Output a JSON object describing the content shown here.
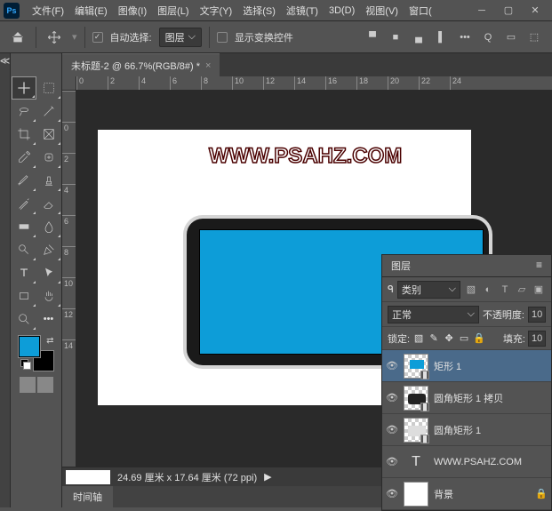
{
  "menubar": {
    "items": [
      "文件(F)",
      "编辑(E)",
      "图像(I)",
      "图层(L)",
      "文字(Y)",
      "选择(S)",
      "滤镜(T)",
      "3D(D)",
      "视图(V)",
      "窗口("
    ]
  },
  "optbar": {
    "auto_select": "自动选择:",
    "layer": "图层",
    "show_transform": "显示变换控件"
  },
  "doc": {
    "title": "未标题-2 @ 66.7%(RGB/8#) *"
  },
  "ruler_h": [
    "0",
    "2",
    "4",
    "6",
    "8",
    "10",
    "12",
    "14",
    "16",
    "18",
    "20",
    "22",
    "24"
  ],
  "ruler_v": [
    "",
    "0",
    "2",
    "4",
    "6",
    "8",
    "10",
    "12",
    "14"
  ],
  "watermark": "WWW.PSAHZ.COM",
  "status": {
    "dim": "24.69 厘米 x 17.64 厘米 (72 ppi)",
    "arrow": "▶"
  },
  "timeline": "时间轴",
  "layers_panel": {
    "title": "图层",
    "kind": "类别",
    "mode": "正常",
    "opacity": "不透明度:",
    "opacity_val": "10",
    "lock": "锁定:",
    "fill": "填充:",
    "fill_val": "10",
    "items": [
      {
        "name": "矩形 1"
      },
      {
        "name": "圆角矩形 1 拷贝"
      },
      {
        "name": "圆角矩形 1"
      },
      {
        "name": "WWW.PSAHZ.COM"
      },
      {
        "name": "背景"
      }
    ]
  }
}
